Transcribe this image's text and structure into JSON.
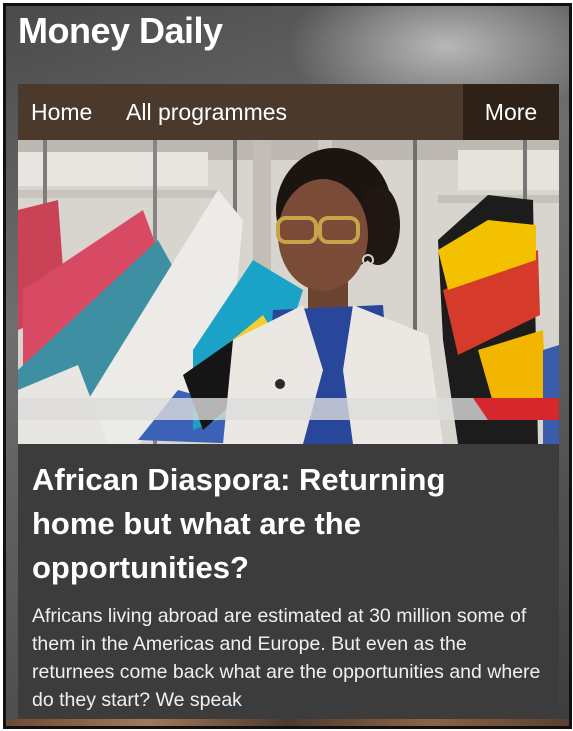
{
  "header": {
    "title": "Money Daily"
  },
  "nav": {
    "items": [
      {
        "label": "Home"
      },
      {
        "label": "All programmes"
      }
    ],
    "more_label": "More"
  },
  "article": {
    "headline": "African Diaspora: Returning home but what are the opportunities?",
    "summary": "Africans living abroad are estimated at 30 million some of them in the Americas and Europe. But even as the returnees come back what are the opportunities and where do they start? We speak"
  },
  "colors": {
    "nav_background": "#4b3a2c",
    "more_background": "#2e2117",
    "card_background": "#3c3c3c",
    "text": "#ffffff"
  }
}
